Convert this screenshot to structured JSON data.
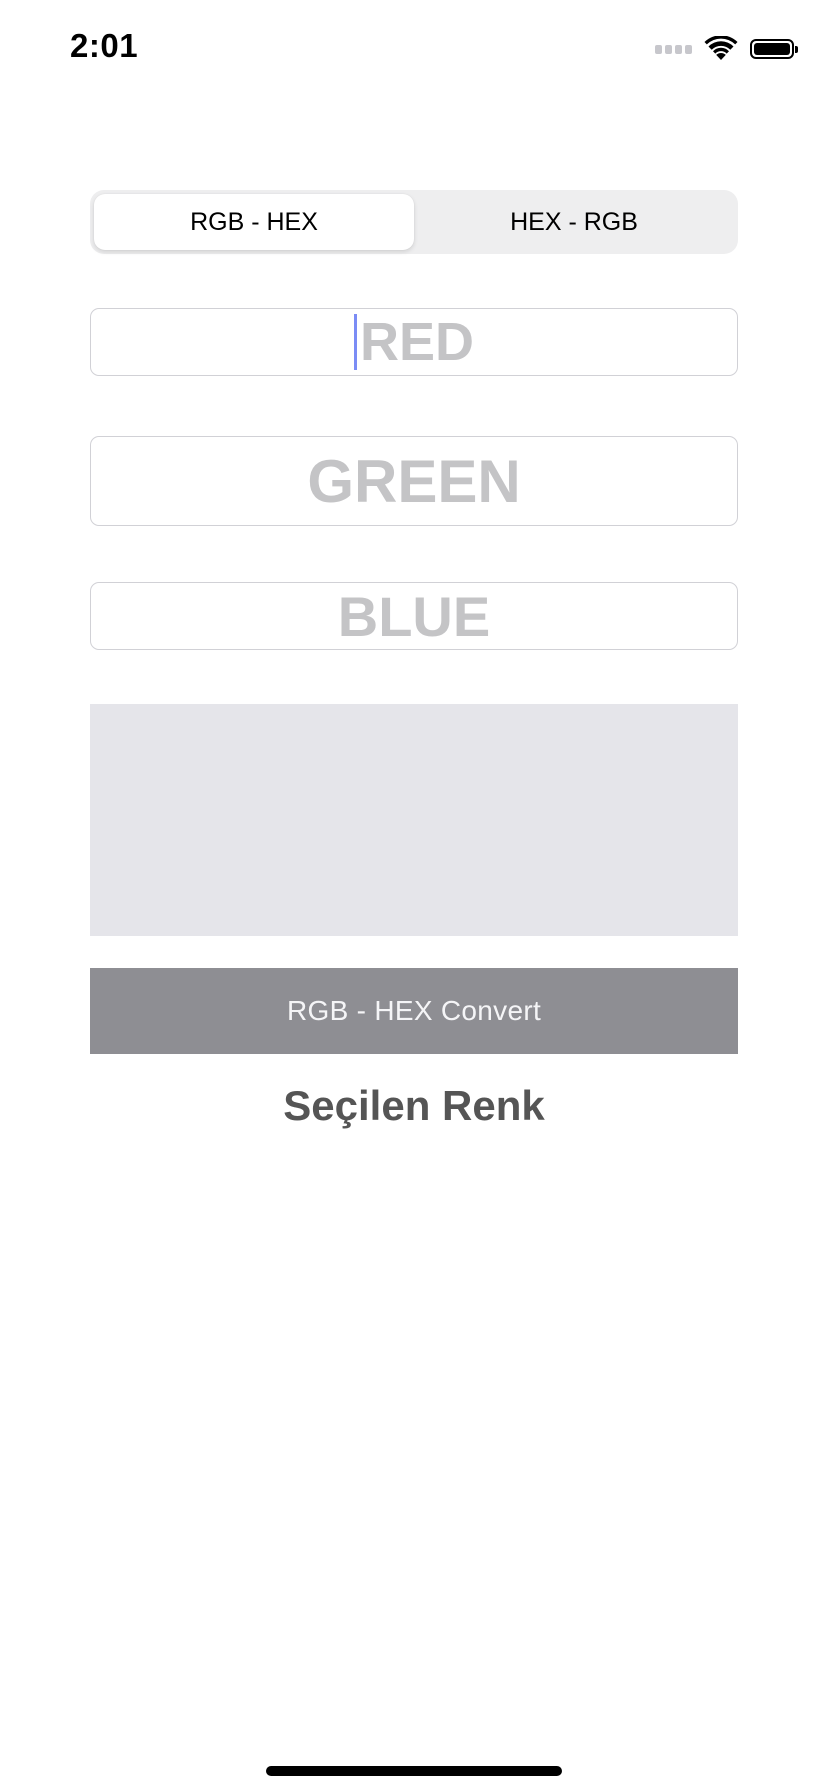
{
  "status_bar": {
    "time": "2:01",
    "signal_icon": "signal-dots-icon",
    "wifi_icon": "wifi-icon",
    "battery_icon": "battery-icon"
  },
  "segmented_control": {
    "segments": [
      {
        "label": "RGB - HEX",
        "selected": true
      },
      {
        "label": "HEX - RGB",
        "selected": false
      }
    ]
  },
  "inputs": {
    "red": {
      "placeholder": "RED",
      "value": ""
    },
    "green": {
      "placeholder": "GREEN",
      "value": ""
    },
    "blue": {
      "placeholder": "BLUE",
      "value": ""
    }
  },
  "preview": {
    "color": "#e5e5ea"
  },
  "convert_button": {
    "label": "RGB - HEX Convert"
  },
  "result": {
    "label": "Seçilen Renk"
  },
  "colors": {
    "segment_bg": "#eeeeef",
    "placeholder": "#c4c4c6",
    "button_bg": "#8e8e93",
    "cursor": "#7b8cf5"
  }
}
